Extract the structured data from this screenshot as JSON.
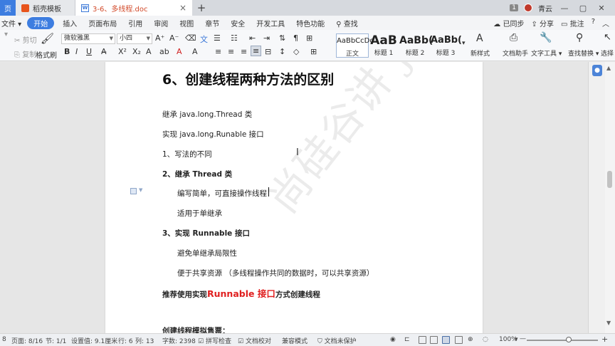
{
  "tabs": {
    "first_label": "页",
    "template_tab": "稻壳模板",
    "doc_tab": "3-6、多线程.doc",
    "add_label": "+"
  },
  "titlebar": {
    "badge": "1",
    "user": "青云",
    "win_min": "—",
    "win_max": "▢",
    "win_close": "✕"
  },
  "menu": {
    "file": "文件",
    "items": [
      "开始",
      "插入",
      "页面布局",
      "引用",
      "审阅",
      "视图",
      "章节",
      "安全",
      "开发工具",
      "特色功能",
      "查找"
    ],
    "right": [
      "已同步",
      "分享",
      "批注",
      "?",
      "︿"
    ]
  },
  "ribbon": {
    "cut": "剪切",
    "copy": "复制",
    "format_painter": "格式刷",
    "font_name": "微软雅黑",
    "font_size": "小四",
    "styles": [
      {
        "sample": "AaBbCcDd",
        "name": "正文"
      },
      {
        "sample": "AaB",
        "name": "标题 1"
      },
      {
        "sample": "AaBb(",
        "name": "标题 2"
      },
      {
        "sample": "AaBb(",
        "name": "标题 3"
      }
    ],
    "new_style": "新样式",
    "doc_assistant": "文档助手",
    "text_tools": "文字工具",
    "find_replace": "查找替换",
    "select": "选择"
  },
  "document": {
    "heading": "6、创建线程两种方法的区别",
    "lines": {
      "l1": "继承 java.long.Thread 类",
      "l2": "实现 java.long.Runable 接口",
      "l3": "1、写法的不同",
      "l4": "2、继承 Thread 类",
      "l5": "编写简单，可直接操作线程",
      "l6": "适用于单继承",
      "l7": "3、实现 Runnable 接口",
      "l8": "避免单继承局限性",
      "l9": "便于共享资源   （多线程操作共同的数据时，可以共享资源）",
      "l10_pre": "推荐使用实现",
      "l10_red": "Runnable 接口",
      "l10_post": "方式创建线程",
      "l11": "创建线程模拟售票："
    },
    "watermark": "尚硅谷讲 java"
  },
  "statusbar": {
    "page_icon": "8",
    "page": "页面: 8/16",
    "section": "节: 1/1",
    "setting": "设置值: 9.1厘米",
    "row": "行: 6",
    "col": "列: 13",
    "words": "字数: 2398",
    "spell": "拼写检查",
    "proof": "文档校对",
    "compat": "兼容模式",
    "unprotected": "文档未保护",
    "zoom": "100%",
    "zoom_minus": "—",
    "zoom_plus": "+"
  }
}
